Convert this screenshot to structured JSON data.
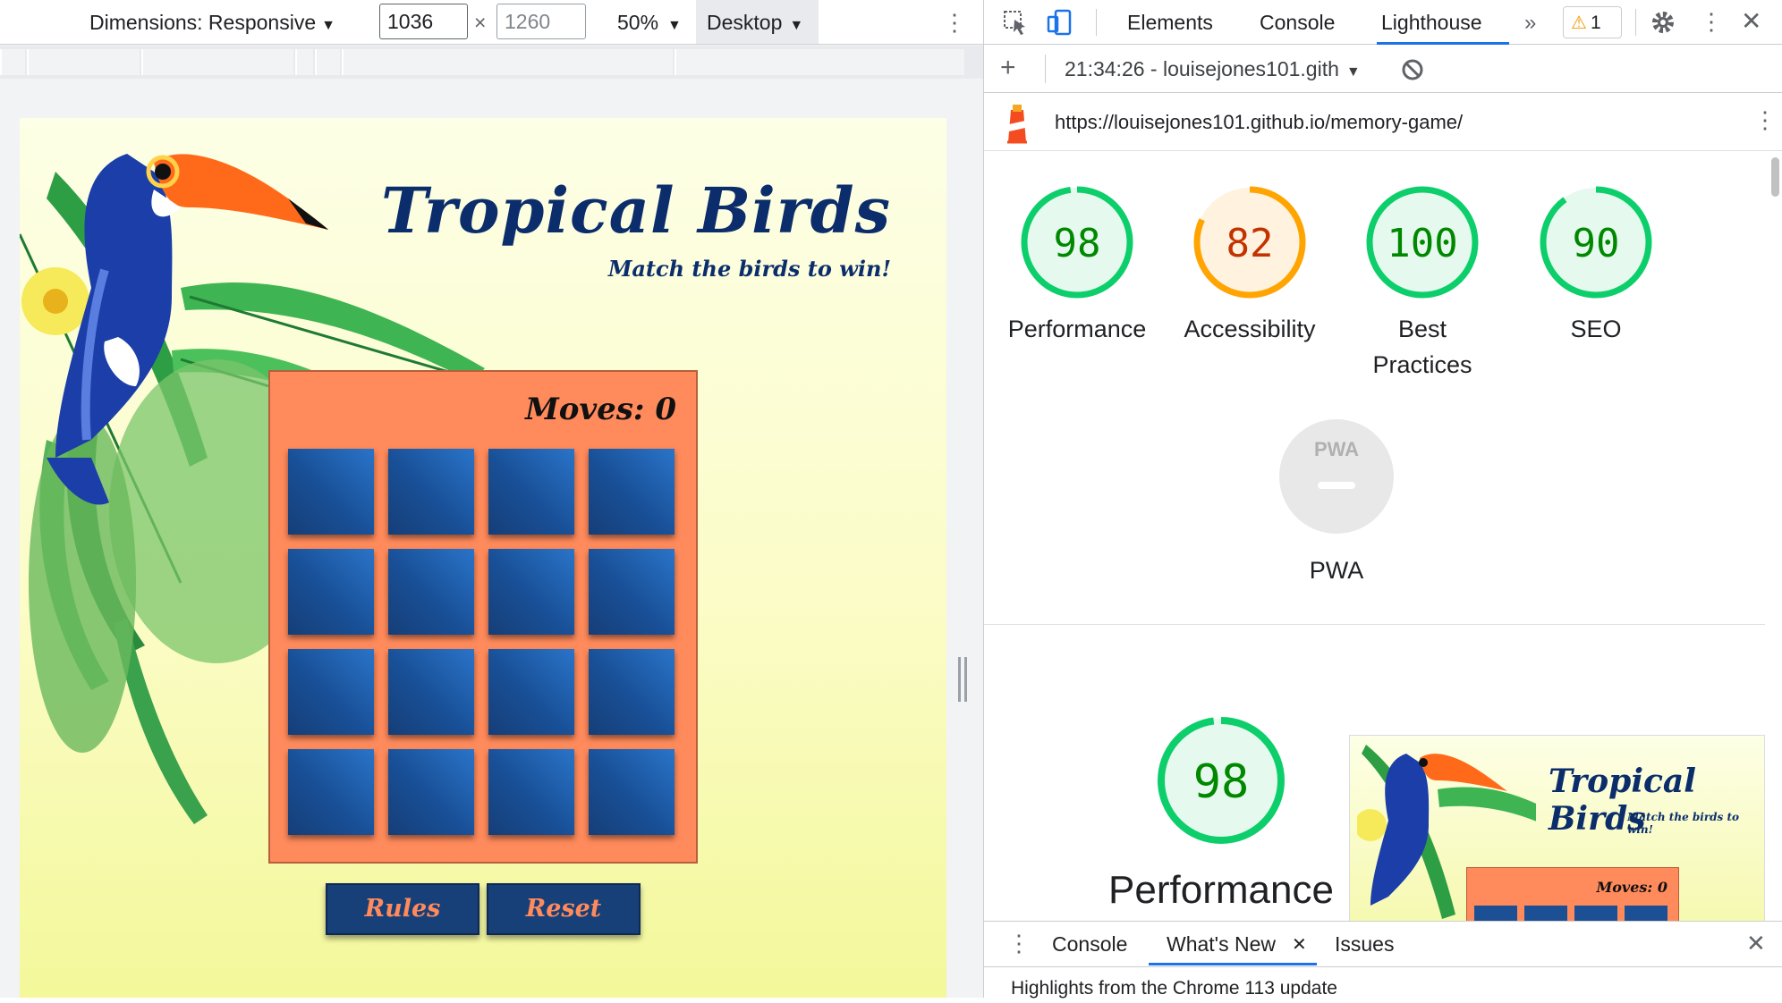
{
  "device_toolbar": {
    "dimensions_label": "Dimensions: Responsive",
    "width_value": "1036",
    "height_placeholder": "1260",
    "times": "×",
    "zoom": "50%",
    "device_mode": "Desktop"
  },
  "game": {
    "title": "Tropical Birds",
    "subtitle": "Match the birds to win!",
    "moves_label": "Moves:",
    "moves_value": "0",
    "card_count": 16,
    "rules_label": "Rules",
    "reset_label": "Reset",
    "colors": {
      "board": "#ff8a5b",
      "card": "#184f96",
      "title": "#0b2d6b",
      "button_text": "#ff8a5b"
    }
  },
  "devtools": {
    "tabs": [
      "Elements",
      "Console",
      "Lighthouse"
    ],
    "active_tab": "Lighthouse",
    "more": "»",
    "warning_count": "1",
    "report_selector": "21:34:26 - louisejones101.gith",
    "report_url": "https://louisejones101.github.io/memory-game/",
    "scores": [
      {
        "name": "Performance",
        "value": 98,
        "color": "#0cce6b",
        "text_color": "#008800",
        "bg": "#e6f9ee"
      },
      {
        "name": "Accessibility",
        "value": 82,
        "color": "#ffa400",
        "text_color": "#c33300",
        "bg": "#fff3e0"
      },
      {
        "name": "Best Practices",
        "value": 100,
        "color": "#0cce6b",
        "text_color": "#008800",
        "bg": "#e6f9ee"
      },
      {
        "name": "SEO",
        "value": 90,
        "color": "#0cce6b",
        "text_color": "#008800",
        "bg": "#e6f9ee"
      }
    ],
    "pwa": {
      "name": "PWA",
      "badge": "PWA"
    },
    "performance_section": {
      "value": 98,
      "label": "Performance"
    },
    "thumb": {
      "title": "Tropical Birds",
      "subtitle": "Match the birds to win!",
      "moves": "Moves: 0"
    },
    "drawer": {
      "tabs": [
        "Console",
        "What's New",
        "Issues"
      ],
      "active_tab": "What's New",
      "content": "Highlights from the Chrome 113 update"
    }
  }
}
